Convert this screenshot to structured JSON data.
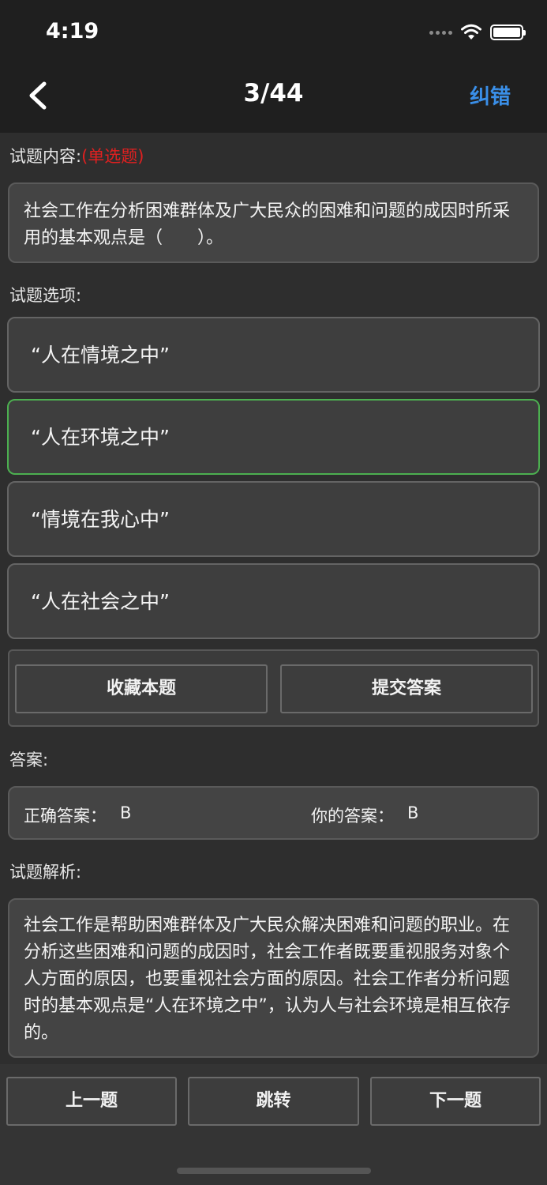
{
  "status_bar": {
    "time": "4:19"
  },
  "nav": {
    "title": "3/44",
    "action_label": "纠错"
  },
  "question": {
    "section_label": "试题内容:",
    "type_tag": "(单选题)",
    "text": "社会工作在分析困难群体及广大民众的困难和问题的成因时所采用的基本观点是（　　）。"
  },
  "options": {
    "section_label": "试题选项:",
    "items": [
      {
        "label": "“人在情境之中”"
      },
      {
        "label": "“人在环境之中”",
        "state": "correct"
      },
      {
        "label": "“情境在我心中”"
      },
      {
        "label": "“人在社会之中”"
      }
    ]
  },
  "actions": {
    "favorite_label": "收藏本题",
    "submit_label": "提交答案"
  },
  "answer": {
    "section_label": "答案:",
    "correct_label": "正确答案：",
    "correct_value": "B",
    "yours_label": "你的答案：",
    "yours_value": "B"
  },
  "analysis": {
    "section_label": "试题解析:",
    "text": "社会工作是帮助困难群体及广大民众解决困难和问题的职业。在分析这些困难和问题的成因时，社会工作者既要重视服务对象个人方面的原因，也要重视社会方面的原因。社会工作者分析问题时的基本观点是“人在环境之中”，认为人与社会环境是相互依存的。"
  },
  "footer": {
    "prev_label": "上一题",
    "jump_label": "跳转",
    "next_label": "下一题"
  },
  "colors": {
    "accent": "#3a8fe8",
    "type_tag": "#e02020",
    "correct_border": "#4caf50",
    "background": "#2e2e2e",
    "nav_background": "#1f1f1f"
  },
  "icons": {
    "back": "chevron-left-icon",
    "wifi": "wifi-icon",
    "battery": "battery-icon",
    "signal": "signal-icon"
  }
}
